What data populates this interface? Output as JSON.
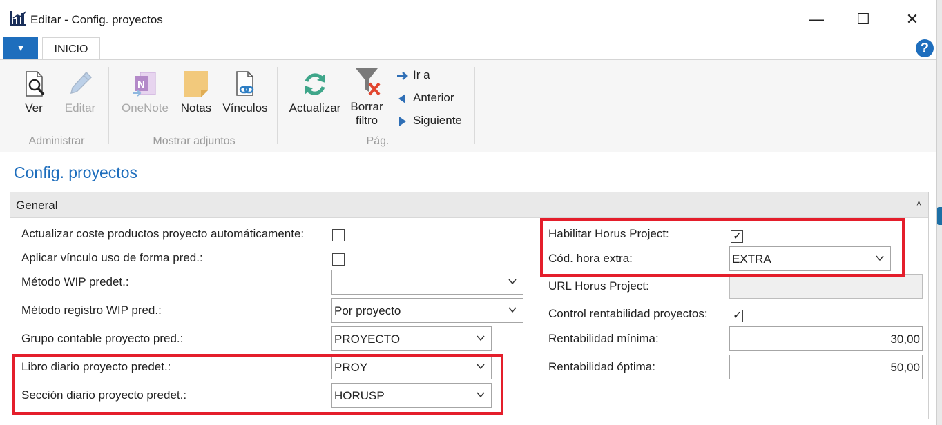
{
  "window": {
    "title": "Editar - Config. proyectos",
    "minimize_glyph": "—",
    "maximize_glyph": "☐",
    "close_glyph": "✕"
  },
  "tabs": {
    "file_glyph": "▼",
    "inicio_label": "INICIO",
    "help_glyph": "?"
  },
  "ribbon": {
    "administrar": {
      "label": "Administrar",
      "ver": "Ver",
      "editar": "Editar"
    },
    "adjuntos": {
      "label": "Mostrar adjuntos",
      "onenote": "OneNote",
      "notas": "Notas",
      "vinculos": "Vínculos"
    },
    "pag": {
      "label": "Pág.",
      "actualizar": "Actualizar",
      "borrar_filtro_line1": "Borrar",
      "borrar_filtro_line2": "filtro",
      "ir_a": "Ir a",
      "anterior": "Anterior",
      "siguiente": "Siguiente"
    }
  },
  "page_title": "Config. proyectos",
  "section": {
    "title": "General",
    "collapse_glyph": "˄"
  },
  "left_fields": {
    "actualizar_coste": {
      "label": "Actualizar coste productos proyecto automáticamente:",
      "checked": false
    },
    "aplicar_vinculo": {
      "label": "Aplicar vínculo uso de forma pred.:",
      "checked": false
    },
    "metodo_wip": {
      "label": "Método WIP predet.:",
      "value": ""
    },
    "metodo_registro_wip": {
      "label": "Método registro WIP pred.:",
      "value": "Por proyecto"
    },
    "grupo_contable": {
      "label": "Grupo contable proyecto pred.:",
      "value": "PROYECTO"
    },
    "libro_diario": {
      "label": "Libro diario proyecto predet.:",
      "value": "PROY"
    },
    "seccion_diario": {
      "label": "Sección diario proyecto predet.:",
      "value": "HORUSP"
    }
  },
  "right_fields": {
    "habilitar_horus": {
      "label": "Habilitar Horus Project:",
      "checked": true,
      "check_glyph": "✓"
    },
    "cod_hora_extra": {
      "label": "Cód. hora extra:",
      "value": "EXTRA"
    },
    "url_horus": {
      "label": "URL Horus Project:",
      "value": ""
    },
    "control_rentabilidad": {
      "label": "Control rentabilidad proyectos:",
      "checked": true,
      "check_glyph": "✓"
    },
    "rentabilidad_minima": {
      "label": "Rentabilidad mínima:",
      "value": "30,00"
    },
    "rentabilidad_optima": {
      "label": "Rentabilidad óptima:",
      "value": "50,00"
    }
  },
  "colors": {
    "accent": "#1e6ebd",
    "highlight_border": "#e41e2b"
  }
}
